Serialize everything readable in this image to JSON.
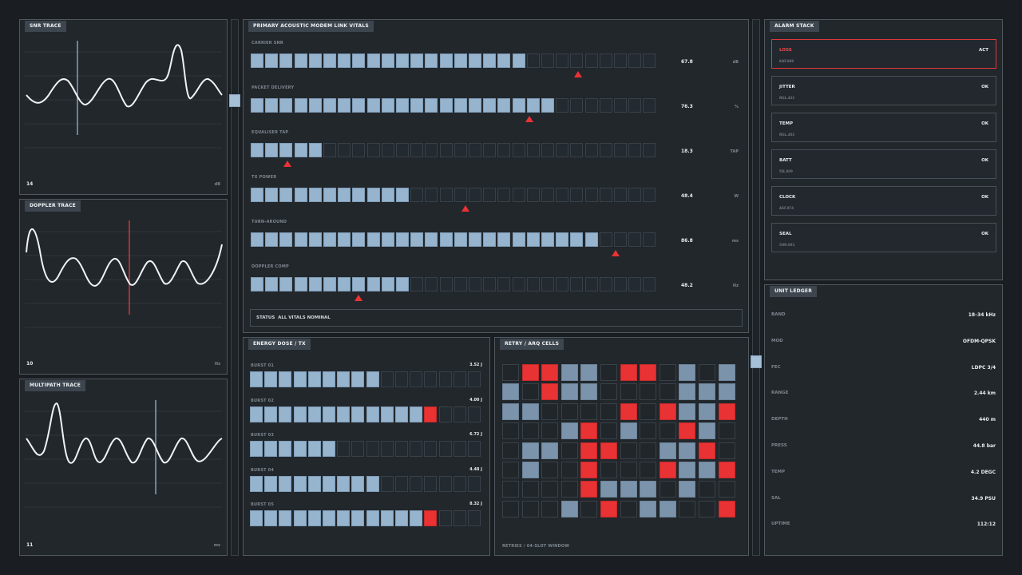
{
  "traces": [
    {
      "title": "SNR TRACE",
      "value": "14",
      "unit": "dB"
    },
    {
      "title": "DOPPLER TRACE",
      "value": "10",
      "unit": "Hz"
    },
    {
      "title": "MULTIPATH TRACE",
      "value": "11",
      "unit": "ms"
    }
  ],
  "vitals": {
    "title": "PRIMARY ACOUSTIC MODEM LINK VITALS",
    "rows": [
      {
        "label": "CARRIER SNR",
        "value": "67.8",
        "unit": "dB",
        "filled": 19,
        "marker": 22.5
      },
      {
        "label": "PACKET DELIVERY",
        "value": "76.3",
        "unit": "%",
        "filled": 21,
        "marker": 19.2
      },
      {
        "label": "EQUALISER TAP",
        "value": "18.3",
        "unit": "TAP",
        "filled": 5,
        "marker": 2.5
      },
      {
        "label": "TX POWER",
        "value": "48.4",
        "unit": "W",
        "filled": 11,
        "marker": 14.8
      },
      {
        "label": "TURN-AROUND",
        "value": "86.8",
        "unit": "ms",
        "filled": 24,
        "marker": 25.1
      },
      {
        "label": "DOPPLER COMP",
        "value": "48.2",
        "unit": "Hz",
        "filled": 11,
        "marker": 7.4
      }
    ],
    "status": "STATUS  ALL VITALS NOMINAL"
  },
  "energy": {
    "title": "ENERGY DOSE / TX",
    "rows": [
      {
        "label": "BURST 01",
        "value": "3.52 J",
        "filled": 9,
        "red": false
      },
      {
        "label": "BURST 02",
        "value": "4.00 J",
        "filled": 13,
        "red": true
      },
      {
        "label": "BURST 03",
        "value": "6.72 J",
        "filled": 6,
        "red": false
      },
      {
        "label": "BURST 04",
        "value": "4.48 J",
        "filled": 9,
        "red": false
      },
      {
        "label": "BURST 05",
        "value": "8.32 J",
        "filled": 13,
        "red": true
      }
    ]
  },
  "retry": {
    "title": "RETRY / ARQ CELLS",
    "grid": [
      "_rrbb_rr_b_b",
      "b_rbb____bbb",
      "bb____r_rbbr",
      "___br_b__r b",
      "_bb_rr__bbr_",
      "_b__r___rbbr",
      "____rbbb_b__",
      "___b_r_bb_ _r"
    ],
    "footer": "RETRIES / 64-SLOT WINDOW"
  },
  "alarms": {
    "title": "ALARM STACK",
    "items": [
      {
        "name": "LOSS",
        "code": "KAF.889",
        "state": "ACT",
        "active": true
      },
      {
        "name": "JITTER",
        "code": "NGL.433",
        "state": "OK",
        "active": false
      },
      {
        "name": "TEMP",
        "code": "NGL.403",
        "state": "OK",
        "active": false
      },
      {
        "name": "BATT",
        "code": "5IE.809",
        "state": "OK",
        "active": false
      },
      {
        "name": "CLOCK",
        "code": "ASF.974",
        "state": "OK",
        "active": false
      },
      {
        "name": "SEAL",
        "code": "5HN.891",
        "state": "OK",
        "active": false
      }
    ]
  },
  "ledger": {
    "title": "UNIT LEDGER",
    "rows": [
      {
        "key": "BAND",
        "value": "18–34 kHz"
      },
      {
        "key": "MOD",
        "value": "OFDM-QPSK"
      },
      {
        "key": "FEC",
        "value": "LDPC 3/4"
      },
      {
        "key": "RANGE",
        "value": "2.44 km"
      },
      {
        "key": "DEPTH",
        "value": "440 m"
      },
      {
        "key": "PRESS",
        "value": "44.8 bar"
      },
      {
        "key": "TEMP",
        "value": "4.2  DEGC"
      },
      {
        "key": "SAL",
        "value": "34.9 PSU"
      },
      {
        "key": "UPTIME",
        "value": "112:12"
      }
    ]
  },
  "colors": {
    "accent": "#97b4cf",
    "alarm": "#ea3233",
    "panel": "#22272c",
    "background": "#1a1e22"
  }
}
